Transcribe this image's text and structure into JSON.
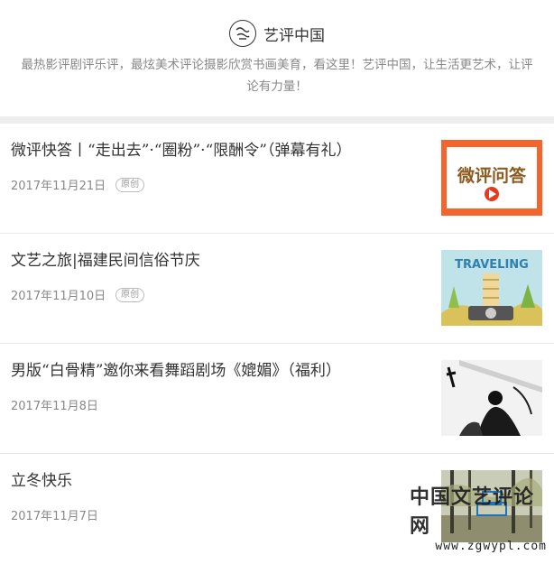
{
  "header": {
    "brand_name": "艺评中国",
    "intro": "最热影评剧评乐评，最炫美术评论摄影欣赏书画美育，看这里！艺评中国，让生活更艺术，让评论有力量！"
  },
  "articles": [
    {
      "title": "微评快答丨“走出去”·“圈粉”·“限酬令”（弹幕有礼）",
      "date": "2017年11月21日",
      "tag": "原创",
      "thumb_text": "微评问答",
      "thumb_icon": "play-icon"
    },
    {
      "title": "文艺之旅|福建民间信俗节庆",
      "date": "2017年11月10日",
      "tag": "原创",
      "thumb_text": "TRAVELING",
      "thumb_icon": "tower-icon"
    },
    {
      "title": "男版“白骨精”邀你来看舞蹈剧场《媲媚》（福利）",
      "date": "2017年11月8日",
      "tag": "",
      "thumb_text": "",
      "thumb_icon": "dance-photo"
    },
    {
      "title": "立冬快乐",
      "date": "2017年11月7日",
      "tag": "",
      "thumb_text": "",
      "thumb_icon": "trees-photo"
    }
  ],
  "watermark": {
    "cn": "中国文艺评论网",
    "url": "www.zgwypl.com"
  },
  "colors": {
    "orange": "#f3652d",
    "play_red": "#e8381e"
  }
}
